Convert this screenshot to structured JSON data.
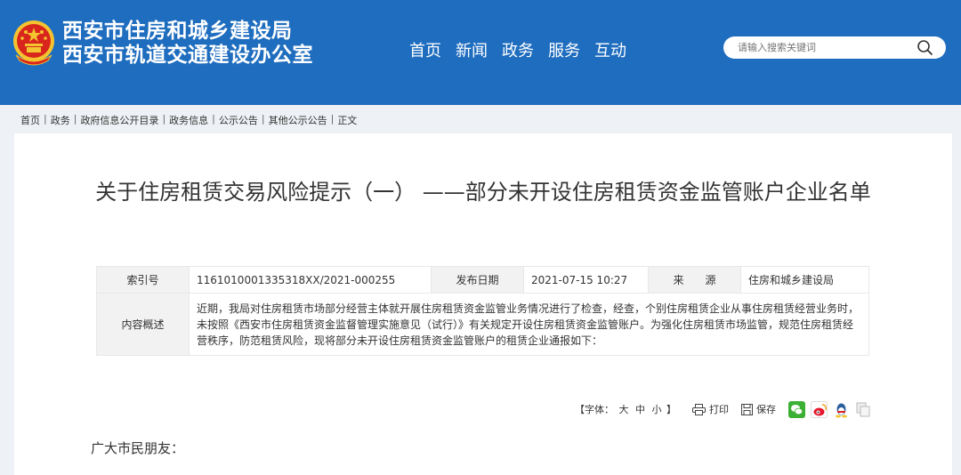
{
  "header": {
    "site_name_line1": "西安市住房和城乡建设局",
    "site_name_line2": "西安市轨道交通建设办公室",
    "emblem_icon": "national-emblem-icon",
    "nav": [
      "首页",
      "新闻",
      "政务",
      "服务",
      "互动"
    ],
    "search_placeholder": "请输入搜索关键词",
    "colors": {
      "header_bg": "#1f6dbf",
      "emblem_red": "#d9261c",
      "emblem_gold": "#f4c430"
    }
  },
  "breadcrumb": [
    "首页",
    "政务",
    "政府信息公开目录",
    "政务信息",
    "公示公告",
    "其他公示公告",
    "正文"
  ],
  "article": {
    "title": "关于住房租赁交易风险提示（一） ——部分未开设住房租赁资金监管账户企业名单",
    "meta": {
      "index_label": "索引号",
      "index_value": "1161010001335318XX/2021-000255",
      "date_label": "发布日期",
      "date_value": "2021-07-15 10:27",
      "source_label": "来　　源",
      "source_value": "住房和城乡建设局",
      "summary_label": "内容概述",
      "summary_value": "近期，我局对住房租赁市场部分经营主体就开展住房租赁资金监管业务情况进行了检查，经查，个别住房租赁企业从事住房租赁经营业务时，未按照《西安市住房租赁资金监督管理实施意见（试行）》有关规定开设住房租赁资金监管账户。为强化住房租赁市场监管，规范住房租赁经营秩序，防范租赁风险，现将部分未开设住房租赁资金监管账户的租赁企业通报如下："
    },
    "tools": {
      "font_prefix": "【字体：",
      "font_large": "大",
      "font_medium": "中",
      "font_small": "小",
      "font_suffix": "】",
      "print_label": "打印",
      "save_label": "保存",
      "share_icons": [
        "wechat-icon",
        "weibo-icon",
        "qq-icon",
        "copy-icon"
      ]
    },
    "greeting": "广大市民朋友："
  }
}
